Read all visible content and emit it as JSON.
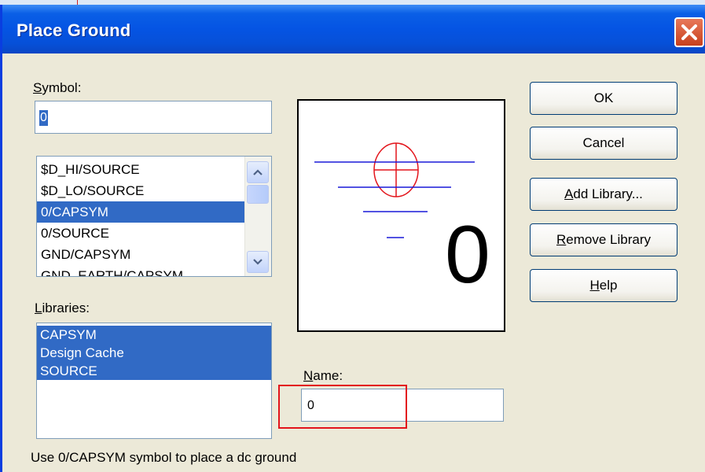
{
  "window": {
    "title": "Place Ground"
  },
  "symbol": {
    "label": "Symbol:",
    "mnemonic": "S",
    "rest": "ymbol:",
    "value": "0"
  },
  "symbol_list": {
    "items": [
      "$D_HI/SOURCE",
      "$D_LO/SOURCE",
      "0/CAPSYM",
      "0/SOURCE",
      "GND/CAPSYM",
      "GND_EARTH/CAPSYM"
    ],
    "selected": "0/CAPSYM"
  },
  "libraries": {
    "label": "Libraries:",
    "mnemonic": "L",
    "rest": "ibraries:",
    "items": [
      "CAPSYM",
      "Design Cache",
      "SOURCE"
    ]
  },
  "preview": {
    "value_text": "0"
  },
  "name": {
    "label": "Name:",
    "mnemonic": "N",
    "rest": "ame:",
    "value": "0"
  },
  "buttons": {
    "ok": "OK",
    "cancel": "Cancel",
    "add_library": {
      "mnemonic": "A",
      "rest": "dd Library..."
    },
    "remove_library": {
      "mnemonic": "R",
      "rest": "emove Library"
    },
    "help": {
      "mnemonic": "H",
      "rest": "elp"
    }
  },
  "status": "Use 0/CAPSYM symbol to place a dc ground",
  "colors": {
    "title_bar": "#0554e3",
    "selection": "#316ac5",
    "preview_red": "#e3141b",
    "preview_blue": "#1a1ad8",
    "highlight_box": "#e3141b"
  }
}
